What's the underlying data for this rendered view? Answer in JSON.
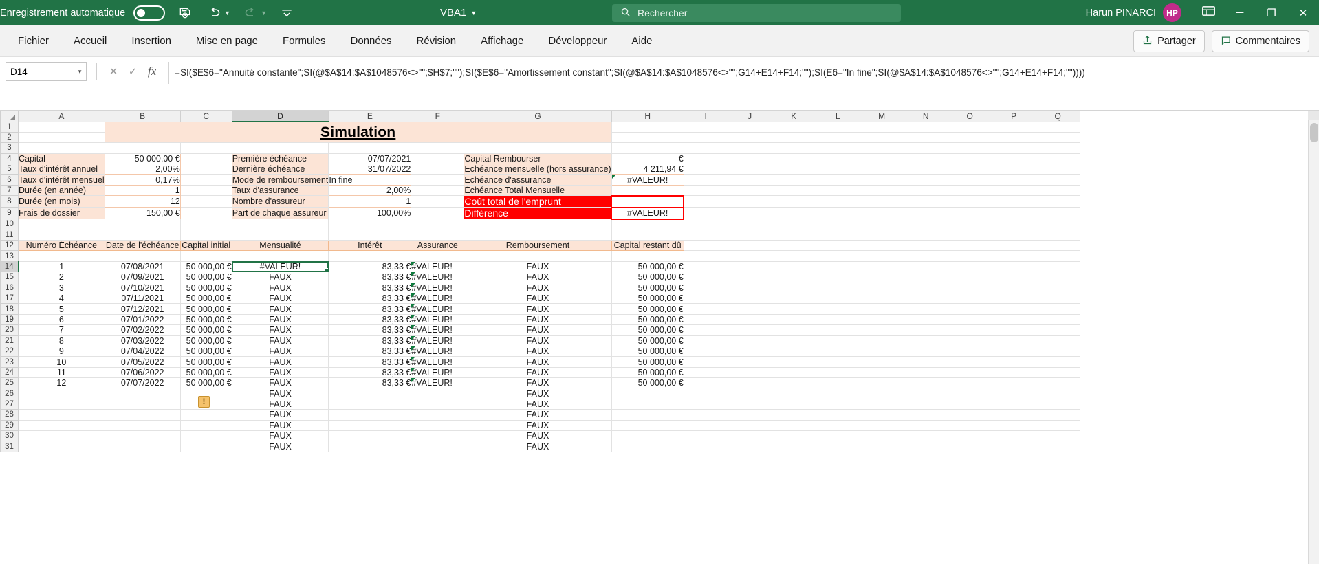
{
  "titlebar": {
    "autosave_label": "Enregistrement automatique",
    "autosave_state": "off",
    "save_icon": "save-refresh-icon",
    "undo_icon": "undo-icon",
    "redo_icon": "redo-icon",
    "customize_icon": "customize-quick-access-icon",
    "document_title": "VBA1",
    "search_placeholder": "Rechercher",
    "search_icon": "search-icon",
    "user_name": "Harun PINARCI",
    "user_initials": "HP",
    "ribbon_display_icon": "ribbon-display-options-icon",
    "minimize": "─",
    "maximize": "❐",
    "close": "✕",
    "brand_color": "#217346",
    "avatar_color": "#c02b8a"
  },
  "ribbon_tabs": [
    "Fichier",
    "Accueil",
    "Insertion",
    "Mise en page",
    "Formules",
    "Données",
    "Révision",
    "Affichage",
    "Développeur",
    "Aide"
  ],
  "ribbon_right": {
    "share_label": "Partager",
    "share_icon": "share-icon",
    "comments_label": "Commentaires",
    "comments_icon": "comment-icon"
  },
  "formula_bar": {
    "name_box": "D14",
    "cancel_icon": "cancel-x-icon",
    "confirm_icon": "confirm-check-icon",
    "fx_icon": "insert-function-icon",
    "expand_icon": "expand-formula-bar-icon",
    "formula": "=SI($E$6=\"Annuité constante\";SI(@$A$14:$A$1048576<>\"\";$H$7;\"\");SI($E$6=\"Amortissement constant\";SI(@$A$14:$A$1048576<>\"\";G14+E14+F14;\"\");SI(E6=\"In fine\";SI(@$A$14:$A$1048576<>\"\";G14+E14+F14;\"\"))))"
  },
  "sheet": {
    "columns": [
      "A",
      "B",
      "C",
      "D",
      "E",
      "F",
      "G",
      "H",
      "I",
      "J",
      "K",
      "L",
      "M",
      "N",
      "O",
      "P",
      "Q"
    ],
    "selected_column": "D",
    "selected_row": 14,
    "selected_cell": "D14",
    "row_numbers": [
      1,
      2,
      3,
      4,
      5,
      6,
      7,
      8,
      9,
      10,
      11,
      12,
      13,
      14,
      15,
      16,
      17,
      18,
      19,
      20,
      21,
      22,
      23,
      24,
      25,
      26,
      27,
      28,
      29,
      30,
      31
    ],
    "banner_title": "Simulation",
    "left_block": [
      {
        "label": "Capital",
        "value": "50 000,00 €"
      },
      {
        "label": "Taux d'intérêt annuel",
        "value": "2,00%"
      },
      {
        "label": "Taux d'intérêt mensuel",
        "value": "0,17%"
      },
      {
        "label": "Durée (en année)",
        "value": "1"
      },
      {
        "label": "Durée (en mois)",
        "value": "12"
      },
      {
        "label": "Frais de dossier",
        "value": "150,00 €"
      }
    ],
    "mid_block": [
      {
        "label": "Première échéance",
        "value": "07/07/2021",
        "align": "r"
      },
      {
        "label": "Dernière échéance",
        "value": "31/07/2022",
        "align": "r"
      },
      {
        "label": "Mode de remboursement",
        "value": "In fine",
        "align": "l"
      },
      {
        "label": "Taux d'assurance",
        "value": "2,00%",
        "align": "r"
      },
      {
        "label": "Nombre d'assureur",
        "value": "1",
        "align": "r"
      },
      {
        "label": "Part de chaque assureur",
        "value": "100,00%",
        "align": "r"
      }
    ],
    "right_block": [
      {
        "label": "Capital Rembourser",
        "value": "-   €",
        "style": "normal"
      },
      {
        "label": "Echéance mensuelle (hors assurance)",
        "value": "4 211,94 €",
        "style": "normal"
      },
      {
        "label": "Echéance d'assurance",
        "value": "#VALEUR!",
        "style": "error"
      },
      {
        "label": "Échéance Total Mensuelle",
        "value": "",
        "style": "normal"
      },
      {
        "label": "Coût total de l'emprunt",
        "value": "",
        "style": "red"
      },
      {
        "label": "Différence",
        "value": "#VALEUR!",
        "style": "red"
      }
    ],
    "table_headers": [
      "Numéro Échéance",
      "Date de l'échéance",
      "Capital initial",
      "Mensualité",
      "Intérêt",
      "Assurance",
      "Remboursement",
      "Capital restant dû"
    ],
    "table_rows": [
      {
        "num": "1",
        "date": "07/08/2021",
        "capital": "50 000,00 €",
        "mensualite": "#VALEUR!",
        "interet": "83,33 €",
        "assurance": "#VALEUR!",
        "remboursement": "FAUX",
        "restant": "50 000,00 €"
      },
      {
        "num": "2",
        "date": "07/09/2021",
        "capital": "50 000,00 €",
        "mensualite": "FAUX",
        "interet": "83,33 €",
        "assurance": "#VALEUR!",
        "remboursement": "FAUX",
        "restant": "50 000,00 €"
      },
      {
        "num": "3",
        "date": "07/10/2021",
        "capital": "50 000,00 €",
        "mensualite": "FAUX",
        "interet": "83,33 €",
        "assurance": "#VALEUR!",
        "remboursement": "FAUX",
        "restant": "50 000,00 €"
      },
      {
        "num": "4",
        "date": "07/11/2021",
        "capital": "50 000,00 €",
        "mensualite": "FAUX",
        "interet": "83,33 €",
        "assurance": "#VALEUR!",
        "remboursement": "FAUX",
        "restant": "50 000,00 €"
      },
      {
        "num": "5",
        "date": "07/12/2021",
        "capital": "50 000,00 €",
        "mensualite": "FAUX",
        "interet": "83,33 €",
        "assurance": "#VALEUR!",
        "remboursement": "FAUX",
        "restant": "50 000,00 €"
      },
      {
        "num": "6",
        "date": "07/01/2022",
        "capital": "50 000,00 €",
        "mensualite": "FAUX",
        "interet": "83,33 €",
        "assurance": "#VALEUR!",
        "remboursement": "FAUX",
        "restant": "50 000,00 €"
      },
      {
        "num": "7",
        "date": "07/02/2022",
        "capital": "50 000,00 €",
        "mensualite": "FAUX",
        "interet": "83,33 €",
        "assurance": "#VALEUR!",
        "remboursement": "FAUX",
        "restant": "50 000,00 €"
      },
      {
        "num": "8",
        "date": "07/03/2022",
        "capital": "50 000,00 €",
        "mensualite": "FAUX",
        "interet": "83,33 €",
        "assurance": "#VALEUR!",
        "remboursement": "FAUX",
        "restant": "50 000,00 €"
      },
      {
        "num": "9",
        "date": "07/04/2022",
        "capital": "50 000,00 €",
        "mensualite": "FAUX",
        "interet": "83,33 €",
        "assurance": "#VALEUR!",
        "remboursement": "FAUX",
        "restant": "50 000,00 €"
      },
      {
        "num": "10",
        "date": "07/05/2022",
        "capital": "50 000,00 €",
        "mensualite": "FAUX",
        "interet": "83,33 €",
        "assurance": "#VALEUR!",
        "remboursement": "FAUX",
        "restant": "50 000,00 €"
      },
      {
        "num": "11",
        "date": "07/06/2022",
        "capital": "50 000,00 €",
        "mensualite": "FAUX",
        "interet": "83,33 €",
        "assurance": "#VALEUR!",
        "remboursement": "FAUX",
        "restant": "50 000,00 €"
      },
      {
        "num": "12",
        "date": "07/07/2022",
        "capital": "50 000,00 €",
        "mensualite": "FAUX",
        "interet": "83,33 €",
        "assurance": "#VALEUR!",
        "remboursement": "FAUX",
        "restant": "50 000,00 €"
      },
      {
        "num": "",
        "date": "",
        "capital": "",
        "mensualite": "FAUX",
        "interet": "",
        "assurance": "",
        "remboursement": "FAUX",
        "restant": ""
      },
      {
        "num": "",
        "date": "",
        "capital": "",
        "mensualite": "FAUX",
        "interet": "",
        "assurance": "",
        "remboursement": "FAUX",
        "restant": ""
      },
      {
        "num": "",
        "date": "",
        "capital": "",
        "mensualite": "FAUX",
        "interet": "",
        "assurance": "",
        "remboursement": "FAUX",
        "restant": ""
      },
      {
        "num": "",
        "date": "",
        "capital": "",
        "mensualite": "FAUX",
        "interet": "",
        "assurance": "",
        "remboursement": "FAUX",
        "restant": ""
      },
      {
        "num": "",
        "date": "",
        "capital": "",
        "mensualite": "FAUX",
        "interet": "",
        "assurance": "",
        "remboursement": "FAUX",
        "restant": ""
      },
      {
        "num": "",
        "date": "",
        "capital": "",
        "mensualite": "FAUX",
        "interet": "",
        "assurance": "",
        "remboursement": "FAUX",
        "restant": ""
      }
    ],
    "error_warning_icon": "warning-exclamation-icon"
  }
}
